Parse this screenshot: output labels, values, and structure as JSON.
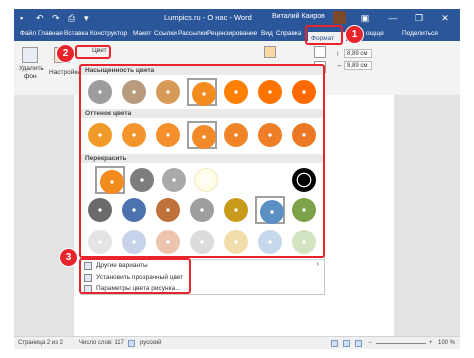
{
  "titlebar": {
    "title": "Lumpics.ru - О нас - Word",
    "user": "Виталий Каиров",
    "buttons": [
      "▣",
      "—",
      "❐",
      "✕"
    ]
  },
  "ribbon_tabs": {
    "file": "Файл",
    "home": "Главная",
    "insert": "Вставка",
    "design": "Конструктор",
    "layout": "Макет",
    "references": "Ссылки",
    "mailings": "Рассылки",
    "review": "Рецензирование",
    "view": "Вид",
    "help": "Справка",
    "format": "Формат",
    "tell": "ощще",
    "share": "Поделиться"
  },
  "ribbon": {
    "remove_bg_line1": "Удалить",
    "remove_bg_line2": "фон",
    "settings": "Настройки",
    "color_button": "Цвет",
    "height_value": "8,89 см",
    "width_value": "8,89 см"
  },
  "color_menu": {
    "saturation_header": "Насыщенность цвета",
    "tone_header": "Оттенок цвета",
    "recolor_header": "Перекрасить",
    "more_variants": "Другие варианты",
    "set_transparent": "Установить прозрачный цвет",
    "picture_color_options": "Параметры цвета рисунка..."
  },
  "swatches": {
    "saturation": [
      "#9d9d9d",
      "#b89a7c",
      "#d79a58",
      "#f28c1e",
      "#ff7f00",
      "#ff7300",
      "#ff6a00"
    ],
    "tone": [
      "#f09a2a",
      "#f3952c",
      "#f48f2c",
      "#f28a2a",
      "#f08429",
      "#ee7e27",
      "#ec7826"
    ],
    "recolor_row1": [
      "#f28a1e",
      "#7d7d7d",
      "#a9a9a9",
      "#fffbe0",
      "#000000"
    ],
    "recolor_row2": [
      "#6a6a6a",
      "#4c72b0",
      "#c0703a",
      "#9e9e9e",
      "#c99b1c",
      "#5b8fc4",
      "#7ca24a"
    ],
    "recolor_row3": [
      "#e4e4e4",
      "#c6d3ea",
      "#edc4ae",
      "#dcdcdc",
      "#f2deaa",
      "#c6d8ec",
      "#d2e4c2"
    ]
  },
  "callouts": [
    "1",
    "2",
    "3"
  ],
  "statusbar": {
    "page": "Страница 2 из 2",
    "words": "Число слов: 117",
    "language": "русский",
    "zoom": "100 %"
  }
}
